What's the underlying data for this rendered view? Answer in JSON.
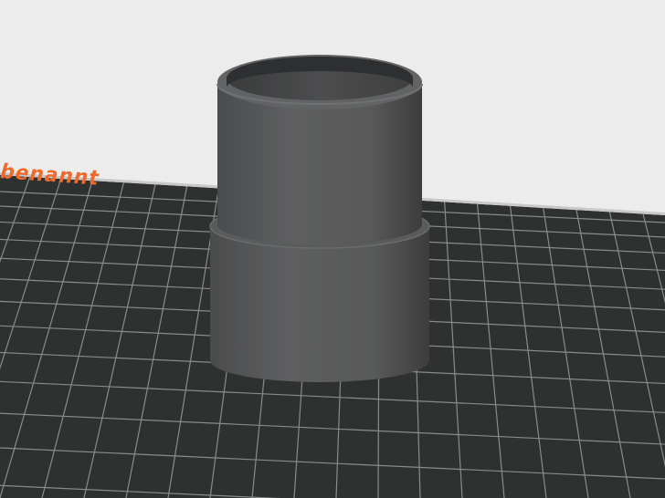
{
  "viewport": {
    "background_color": "#ececec",
    "bed_color": "#2f3030",
    "grid_line_color": "#8a8c8c",
    "label_color": "#ee6a2c",
    "model_color": "#555657"
  },
  "bed": {
    "label": "benannt"
  }
}
